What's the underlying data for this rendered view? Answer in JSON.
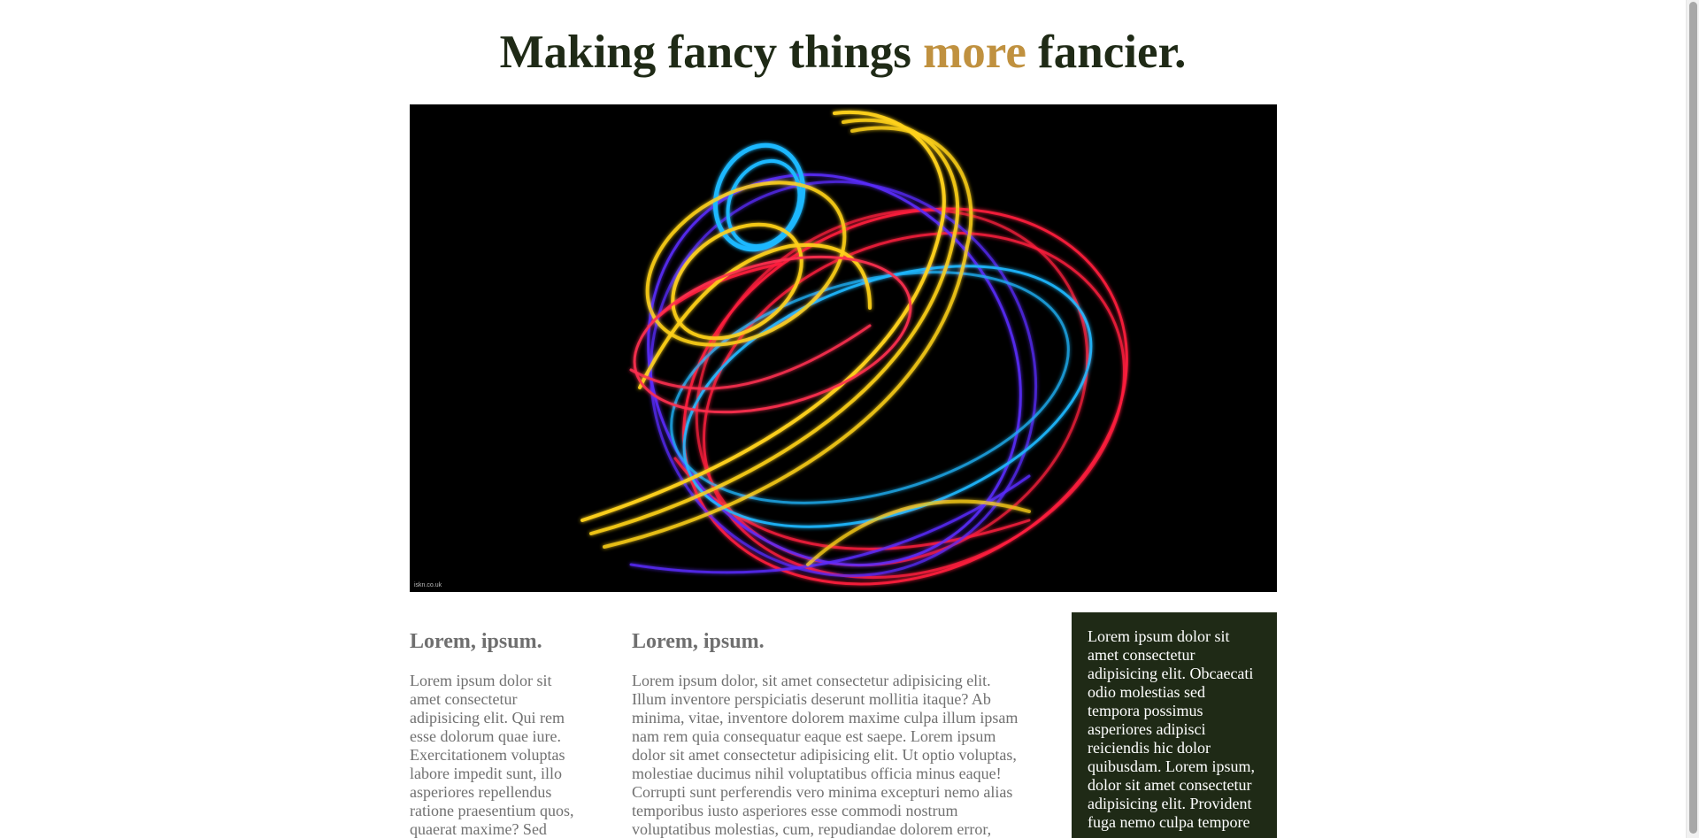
{
  "header": {
    "title_part1": "Making fancy things ",
    "title_accent": "more",
    "title_part2": " fancier."
  },
  "hero": {
    "watermark": "iskn.co.uk"
  },
  "columns": [
    {
      "heading": "Lorem, ipsum.",
      "text": "Lorem ipsum dolor sit amet consectetur adipisicing elit. Qui rem esse dolorum quae iure. Exercitationem voluptas labore impedit sunt, illo asperiores repellendus ratione praesentium quos, quaerat maxime? Sed"
    },
    {
      "heading": "Lorem, ipsum.",
      "text": "Lorem ipsum dolor, sit amet consectetur adipisicing elit. Illum inventore perspiciatis deserunt mollitia itaque? Ab minima, vitae, inventore dolorem maxime culpa illum ipsam nam rem quia consequatur eaque est saepe. Lorem ipsum dolor sit amet consectetur adipisicing elit. Ut optio voluptas, molestiae ducimus nihil voluptatibus officia minus eaque! Corrupti sunt perferendis vero minima excepturi nemo alias temporibus iusto asperiores esse commodi nostrum voluptatibus molestias, cum, repudiandae dolorem error,"
    }
  ],
  "aside": {
    "text": "Lorem ipsum dolor sit amet consectetur adipisicing elit. Obcaecati odio molestias sed tempora possimus asperiores adipisci reiciendis hic dolor quibusdam. Lorem ipsum, dolor sit amet consectetur adipisicing elit. Provident fuga nemo culpa tempore"
  },
  "colors": {
    "dark_green": "#1f2a16",
    "accent_gold": "#c0913f",
    "body_text_gray": "#707070"
  }
}
